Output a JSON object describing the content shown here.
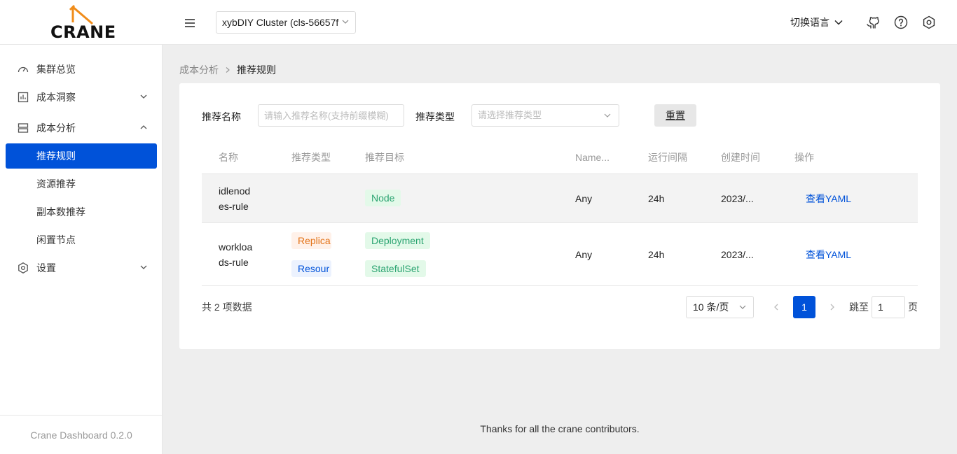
{
  "header": {
    "logo_text": "CRANE",
    "cluster": "xybDIY Cluster (cls-56657f",
    "language_label": "切换语言",
    "icons": [
      "menu-fold-icon",
      "chevron-down-icon",
      "github-icon",
      "help-circle-icon",
      "settings-icon"
    ]
  },
  "sidebar": {
    "items": [
      {
        "label": "集群总览",
        "icon": "dashboard-icon"
      },
      {
        "label": "成本洞察",
        "icon": "chart-bar-icon"
      },
      {
        "label": "成本分析",
        "icon": "server-icon"
      },
      {
        "label": "推荐规则"
      },
      {
        "label": "资源推荐"
      },
      {
        "label": "副本数推荐"
      },
      {
        "label": "闲置节点"
      },
      {
        "label": "设置",
        "icon": "settings-icon"
      }
    ],
    "footer": "Crane Dashboard 0.2.0"
  },
  "breadcrumb": {
    "parent": "成本分析",
    "current": "推荐规则"
  },
  "filters": {
    "name_label": "推荐名称",
    "name_placeholder": "请输入推荐名称(支持前缀模糊)",
    "type_label": "推荐类型",
    "type_placeholder": "请选择推荐类型",
    "reset_label": "重置"
  },
  "table": {
    "columns": [
      "名称",
      "推荐类型",
      "推荐目标",
      "Name...",
      "运行间隔",
      "创建时间",
      "操作"
    ],
    "rows": [
      {
        "name_line1": "idlenod",
        "name_line2": "es-rule",
        "types": [],
        "targets": [
          "Node"
        ],
        "namespace": "Any",
        "interval": "24h",
        "created": "2023/...",
        "action": "查看YAML"
      },
      {
        "name_line1": "workloa",
        "name_line2": "ds-rule",
        "types": [
          "Replica",
          "Resour"
        ],
        "targets": [
          "Deployment",
          "StatefulSet"
        ],
        "namespace": "Any",
        "interval": "24h",
        "created": "2023/...",
        "action": "查看YAML"
      }
    ]
  },
  "pagination": {
    "total": "共 2 项数据",
    "page_size": "10 条/页",
    "current_page": "1",
    "jump_label": "跳至",
    "jump_value": "1",
    "page_suffix": "页"
  },
  "footer": "Thanks for all the crane contributors.",
  "colors": {
    "primary": "#0052d9",
    "success_bg": "#e3f9e9",
    "success": "#2ba471",
    "warning_bg": "#fff1e9",
    "warning": "#e37318"
  }
}
